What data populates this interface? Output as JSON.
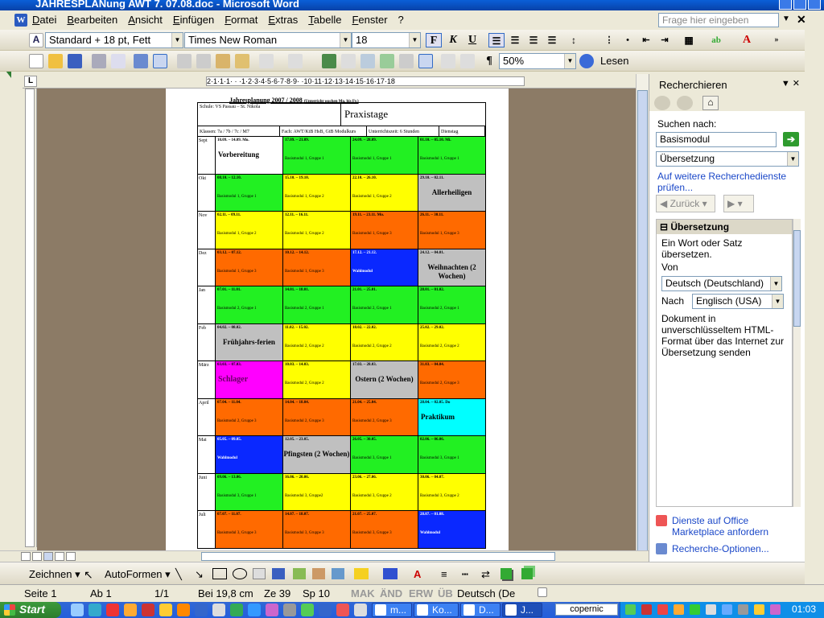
{
  "window": {
    "title": "JAHRESPLANung AWT 7. 07.08.doc - Microsoft Word"
  },
  "menu": [
    "Datei",
    "Bearbeiten",
    "Ansicht",
    "Einfügen",
    "Format",
    "Extras",
    "Tabelle",
    "Fenster",
    "?"
  ],
  "ask": {
    "placeholder": "Frage hier eingeben"
  },
  "format": {
    "style": "Standard + 18 pt, Fett",
    "font": "Times New Roman",
    "size": "18",
    "bold": "F",
    "italic": "K",
    "underline": "U"
  },
  "standard": {
    "zoom": "50%",
    "read": "Lesen"
  },
  "ruler": {
    "marks": "2·1·1·1· · ·1·2·3·4·5·6·7·8·9· ·10·11·12·13·14·15·16·17·18"
  },
  "document": {
    "title": "Jahresplanung  2007 / 2008",
    "title_note": "(Unterricht wochen Mo. bis Fr.)",
    "school": "Schule: VS Passau – St. Nikola",
    "subject_box": "Praxistage",
    "row2": [
      "Klassen:  7a / 7b / 7c / M7",
      "Fach:  AWT/KtB HsB, GtB Modulkurs",
      "Unterrichtszeit: 6 Stunden",
      "Dienstag"
    ],
    "rows": [
      {
        "month": "Sept",
        "cells": [
          {
            "color": "white",
            "date": "10.09. – 14.09. Mo.",
            "big": "Vorbereitung",
            "label": ""
          },
          {
            "color": "green",
            "date": "17.09. – 21.09.",
            "big": "",
            "label": "Basismodul 1, Gruppe 1"
          },
          {
            "color": "green",
            "date": "24.09. – 28.09.",
            "big": "",
            "label": "Basismodul 1, Gruppe 1"
          },
          {
            "color": "green",
            "date": "01.10. – 05.10. Mi.",
            "big": "",
            "label": "Basismodul 1, Gruppe 1"
          }
        ]
      },
      {
        "month": "Okt",
        "cells": [
          {
            "color": "green",
            "date": "08.10. – 12.10.",
            "big": "",
            "label": "Basismodul 1, Gruppe 1"
          },
          {
            "color": "yellow",
            "date": "15.10. – 19.10.",
            "big": "",
            "label": "Basismodul 1, Gruppe 2"
          },
          {
            "color": "yellow",
            "date": "22.10. – 26.10.",
            "big": "",
            "label": "Basismodul 1, Gruppe 2"
          },
          {
            "color": "gray",
            "date": "29.10. – 02.11.",
            "big": "Allerheiligen",
            "label": ""
          }
        ]
      },
      {
        "month": "Nov",
        "cells": [
          {
            "color": "yellow",
            "date": "02.11. – 09.11.",
            "big": "",
            "label": "Basismodul 1, Gruppe 2"
          },
          {
            "color": "yellow",
            "date": "12.11. – 16.11.",
            "big": "",
            "label": "Basismodul 1, Gruppe 2"
          },
          {
            "color": "orange",
            "date": "19.11. – 23.11. Mo.",
            "big": "",
            "label": "Basismodul 1, Gruppe 3"
          },
          {
            "color": "orange",
            "date": "26.11. – 30.11.",
            "big": "",
            "label": "Basismodul 1, Gruppe 3"
          }
        ]
      },
      {
        "month": "Dez",
        "cells": [
          {
            "color": "orange",
            "date": "03.12. – 07.12.",
            "big": "",
            "label": "Basismodul 1, Gruppe 3"
          },
          {
            "color": "orange",
            "date": "10.12. – 14.12.",
            "big": "",
            "label": "Basismodul 1, Gruppe 3"
          },
          {
            "color": "blue",
            "date": "17.12. – 21.12.",
            "big": "",
            "label": "Wahlmodul"
          },
          {
            "color": "gray",
            "date": "24.12. – 04.01.",
            "big": "Weihnachten (2 Wochen)",
            "label": ""
          }
        ]
      },
      {
        "month": "Jan",
        "cells": [
          {
            "color": "green",
            "date": "07.01. – 11.01.",
            "big": "",
            "label": "Basismodul 2, Gruppe 1"
          },
          {
            "color": "green",
            "date": "14.01. – 18.01.",
            "big": "",
            "label": "Basismodul 2, Gruppe 1"
          },
          {
            "color": "green",
            "date": "21.01. – 25.01.",
            "big": "",
            "label": "Basismodul 2, Gruppe 1"
          },
          {
            "color": "green",
            "date": "28.01. – 01.02.",
            "big": "",
            "label": "Basismodul 2, Gruppe 1"
          }
        ]
      },
      {
        "month": "Feb",
        "cells": [
          {
            "color": "gray",
            "date": "04.02. – 08.02.",
            "big": "Frühjahrs-ferien",
            "label": ""
          },
          {
            "color": "yellow",
            "date": "11.02. – 15.02.",
            "big": "",
            "label": "Basismodul 2, Gruppe 2"
          },
          {
            "color": "yellow",
            "date": "18.02. – 22.02.",
            "big": "",
            "label": "Basismodul 2, Gruppe 2"
          },
          {
            "color": "yellow",
            "date": "25.02. – 29.02.",
            "big": "",
            "label": "Basismodul 2, Gruppe 2"
          }
        ]
      },
      {
        "month": "März",
        "cells": [
          {
            "color": "magenta",
            "date": "03.03. – 07.03.",
            "big": "Schlager",
            "label": ""
          },
          {
            "color": "yellow",
            "date": "10.03. – 14.03.",
            "big": "",
            "label": "Basismodul 2, Gruppe 2"
          },
          {
            "color": "gray",
            "date": "17.03. – 28.03.",
            "big": "Ostern (2 Wochen)",
            "label": ""
          },
          {
            "color": "orange",
            "date": "31.03. – 04.04.",
            "big": "",
            "label": "Basismodul 2, Gruppe 3"
          }
        ]
      },
      {
        "month": "April",
        "cells": [
          {
            "color": "orange",
            "date": "07.04. – 11.04.",
            "big": "",
            "label": "Basismodul 2, Gruppe 3"
          },
          {
            "color": "orange",
            "date": "14.04. – 18.04.",
            "big": "",
            "label": "Basismodul 2, Gruppe 3"
          },
          {
            "color": "orange",
            "date": "21.04. – 25.04.",
            "big": "",
            "label": "Basismodul 2, Gruppe 3"
          },
          {
            "color": "cyan",
            "date": "28.04. – 02.05. Do",
            "big": "Praktikum",
            "label": ""
          }
        ]
      },
      {
        "month": "Mai",
        "cells": [
          {
            "color": "blue",
            "date": "05.05. – 09.05.",
            "big": "",
            "label": "Wahlmodul"
          },
          {
            "color": "gray",
            "date": "12.05. – 23.05.",
            "big": "Pfingsten (2 Wochen)",
            "label": ""
          },
          {
            "color": "green",
            "date": "26.05. – 30.05.",
            "big": "",
            "label": "Basismodul 3, Gruppe 1"
          },
          {
            "color": "green",
            "date": "02.06. – 06.06.",
            "big": "",
            "label": "Basismodul 3, Gruppe 1"
          }
        ]
      },
      {
        "month": "Juni",
        "cells": [
          {
            "color": "green",
            "date": "09.06. – 13.06.",
            "big": "",
            "label": "Basismodul 3, Gruppe 1"
          },
          {
            "color": "yellow",
            "date": "16.06. – 20.06.",
            "big": "",
            "label": "Basismodul 3, Gruppe2"
          },
          {
            "color": "yellow",
            "date": "23.06. – 27.06.",
            "big": "",
            "label": "Basismodul 3, Gruppe 2"
          },
          {
            "color": "yellow",
            "date": "30.06. – 04.07.",
            "big": "",
            "label": "Basismodul 3, Gruppe 2"
          }
        ]
      },
      {
        "month": "Juli",
        "cells": [
          {
            "color": "orange",
            "date": "07.07. – 11.07.",
            "big": "",
            "label": "Basismodul 3, Gruppe 3"
          },
          {
            "color": "orange",
            "date": "14.07. – 18.07.",
            "big": "",
            "label": "Basismodul 3, Gruppe 3"
          },
          {
            "color": "orange",
            "date": "21.07. – 25.07.",
            "big": "",
            "label": "Basismodul 3, Gruppe 3"
          },
          {
            "color": "blue",
            "date": "28.07. – 01.08.",
            "big": "",
            "label": "Wahlmodul"
          }
        ]
      }
    ]
  },
  "taskpane": {
    "title": "Recherchieren",
    "search_label": "Suchen nach:",
    "search_value": "Basismodul",
    "service": "Übersetzung",
    "more_link": "Auf weitere Recherchedienste prüfen...",
    "back": "Zurück",
    "section_title": "Übersetzung",
    "section_text": "Ein Wort oder Satz übersetzen.",
    "from_label": "Von",
    "from_value": "Deutsch (Deutschland)",
    "to_label": "Nach",
    "to_value": "Englisch (USA)",
    "info": "Dokument in unverschlüsseltem HTML-Format über das Internet zur Übersetzung senden",
    "marketplace": "Dienste auf Office Marketplace anfordern",
    "options": "Recherche-Optionen..."
  },
  "drawing": {
    "draw": "Zeichnen",
    "autoshapes": "AutoFormen"
  },
  "status": {
    "page": "Seite 1",
    "section": "Ab 1",
    "pages": "1/1",
    "at": "Bei 19,8 cm",
    "line": "Ze 39",
    "col": "Sp 10",
    "mak": "MAK",
    "aend": "ÄND",
    "erw": "ERW",
    "ueb": "ÜB",
    "lang": "Deutsch (De"
  },
  "taskbar": {
    "start": "Start",
    "items": [
      "m...",
      "Ko...",
      "D...",
      "J..."
    ],
    "search": "copernic",
    "time": "01:03"
  },
  "colors": {
    "green": "#22f022",
    "yellow": "#ffff00",
    "orange": "#ff6a00",
    "gray": "#c0c0c0",
    "blue": "#0a28ff",
    "magenta": "#ff00ff",
    "cyan": "#00ffff",
    "white": "#ffffff"
  }
}
